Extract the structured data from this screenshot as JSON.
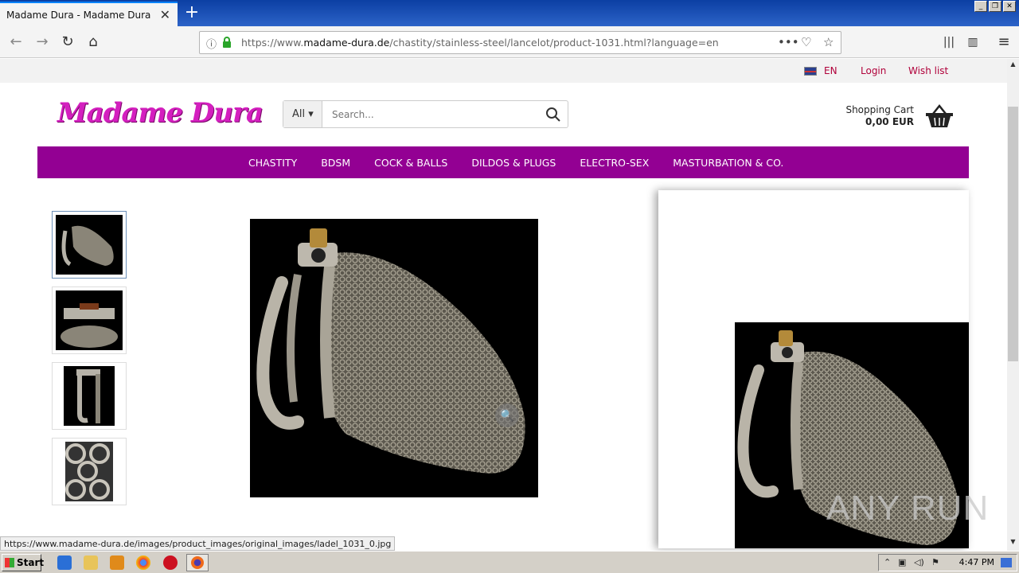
{
  "browser": {
    "tab_title": "Madame Dura - Madame Dura",
    "url_prefix": "https://www.",
    "url_domain": "madame-dura.de",
    "url_path": "/chastity/stainless-steel/lancelot/product-1031.html?language=en",
    "status_url": "https://www.madame-dura.de/images/product_images/original_images/ladel_1031_0.jpg"
  },
  "topbar": {
    "language": "EN",
    "login": "Login",
    "wishlist": "Wish list"
  },
  "header": {
    "logo": "Madame Dura",
    "search_category": "All",
    "search_placeholder": "Search...",
    "cart_label": "Shopping Cart",
    "cart_total": "0,00 EUR"
  },
  "menu": [
    "CHASTITY",
    "BDSM",
    "COCK & BALLS",
    "DILDOS & PLUGS",
    "ELECTRO-SEX",
    "MASTURBATION & CO."
  ],
  "watermark": "ANY RUN",
  "taskbar": {
    "start": "Start",
    "clock": "4:47 PM"
  }
}
